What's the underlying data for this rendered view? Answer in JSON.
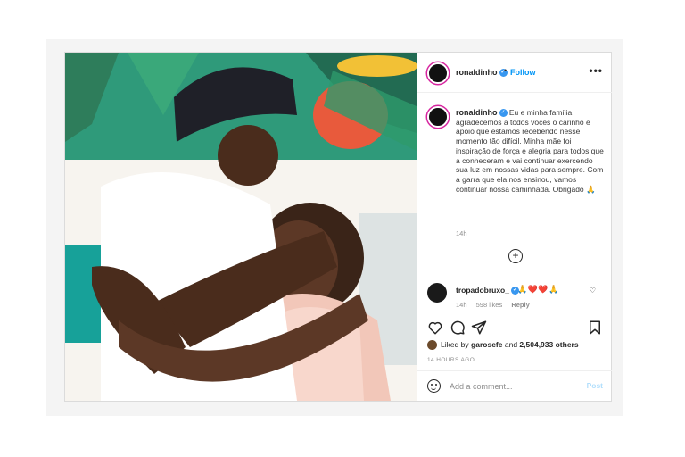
{
  "post": {
    "author": "ronaldinho",
    "follow_label": "Follow",
    "more_label": "•••",
    "caption": {
      "username": "ronaldinho",
      "text": "Eu e minha família agradecemos a todos vocês o carinho e apoio que estamos recebendo nesse momento tão difícil. Minha mãe foi inspiração de força e alegria para todos que a conheceram e vai continuar exercendo sua luz em nossas vidas para sempre. Com a garra que ela nos ensinou, vamos continuar nossa caminhada. Obrigado 🙏",
      "time": "14h"
    },
    "load_more": "+",
    "comment": {
      "username": "tropadobruxo_",
      "text": "🙏❤️❤️🙏",
      "time": "14h",
      "likes": "598 likes",
      "reply": "Reply"
    },
    "likes_line": {
      "prefix": "Liked by",
      "user": "garosefe",
      "middle": "and",
      "count": "2,504,933 others"
    },
    "timestamp": "14 HOURS AGO",
    "add_comment_placeholder": "Add a comment...",
    "post_label": "Post"
  },
  "icons": {
    "verified": "verified-badge-icon",
    "like": "heart-icon",
    "comment": "comment-icon",
    "share": "paper-plane-icon",
    "save": "bookmark-icon",
    "emoji": "smiley-icon",
    "add": "plus-circle-icon"
  },
  "colors": {
    "accent": "#0095f6",
    "verified": "#3897f0",
    "story_ring": "#d6249f",
    "border": "#dbdbdb",
    "muted": "#8e8e8e"
  }
}
